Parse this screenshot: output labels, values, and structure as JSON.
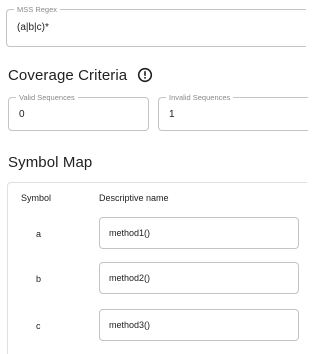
{
  "regex": {
    "label": "MSS Regex",
    "value": "(a|b|c)*"
  },
  "coverage": {
    "title": "Coverage Criteria",
    "info_icon": "info-icon",
    "valid": {
      "label": "Valid Sequences",
      "value": "0"
    },
    "invalid": {
      "label": "Invalid Sequences",
      "value": "1"
    }
  },
  "symbol_map": {
    "title": "Symbol Map",
    "headers": {
      "symbol": "Symbol",
      "name": "Descriptive name"
    },
    "rows": [
      {
        "symbol": "a",
        "name": "method1()"
      },
      {
        "symbol": "b",
        "name": "method2()"
      },
      {
        "symbol": "c",
        "name": "method3()"
      }
    ]
  }
}
